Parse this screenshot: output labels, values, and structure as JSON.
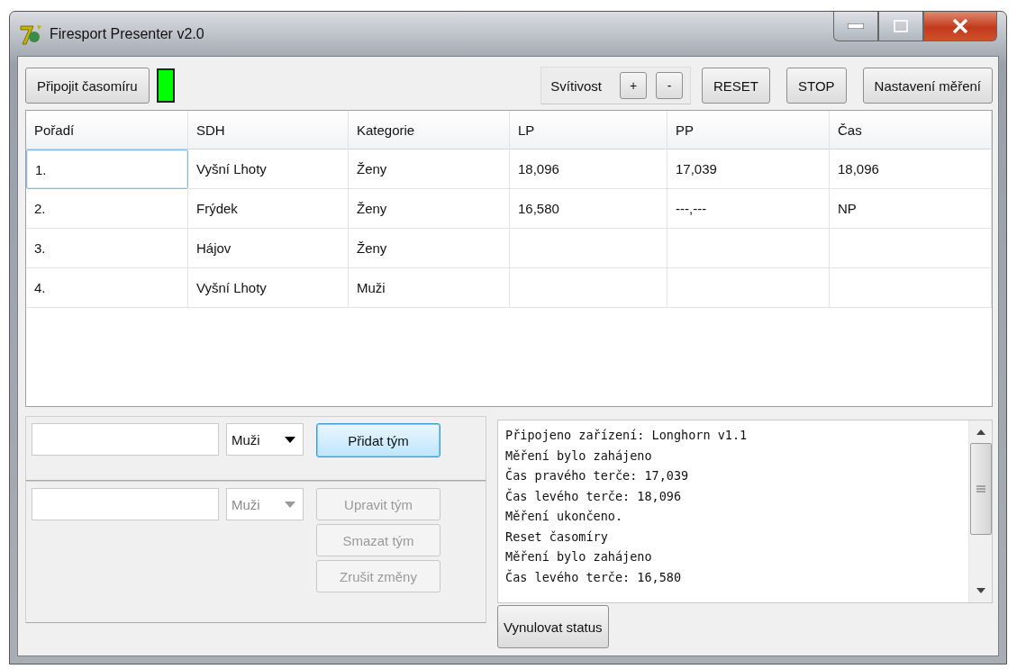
{
  "window": {
    "title": "Firesport Presenter v2.0"
  },
  "toolbar": {
    "connect_button": "Připojit časomíru",
    "connection_ok": true,
    "brightness_label": "Svítivost",
    "plus_button": "+",
    "minus_button": "-",
    "buttons": [
      "RESET",
      "STOP",
      "Nastavení měření"
    ]
  },
  "table": {
    "columns": [
      "Pořadí",
      "SDH",
      "Kategorie",
      "LP",
      "PP",
      "Čas"
    ],
    "rows": [
      {
        "selected": true,
        "cells": [
          "1.",
          "Vyšní Lhoty",
          "Ženy",
          "18,096",
          "17,039",
          "18,096"
        ]
      },
      {
        "selected": false,
        "cells": [
          "2.",
          "Frýdek",
          "Ženy",
          "16,580",
          "---,---",
          "NP"
        ]
      },
      {
        "selected": false,
        "cells": [
          "3.",
          "Hájov",
          "Ženy",
          "",
          "",
          ""
        ]
      },
      {
        "selected": false,
        "cells": [
          "4.",
          "Vyšní Lhoty",
          "Muži",
          "",
          "",
          ""
        ]
      }
    ]
  },
  "add_team": {
    "category": "Muži",
    "disabled": false,
    "button": "Přidat tým"
  },
  "edit_team": {
    "category": "Muži",
    "disabled": true,
    "buttons": [
      "Upravit tým",
      "Smazat tým",
      "Zrušit změny"
    ]
  },
  "log": {
    "lines": [
      "Připojeno zařízení: Longhorn v1.1",
      "Měření bylo zahájeno",
      "Čas pravého terče: 17,039",
      "Čas levého terče: 18,096",
      "Měření ukončeno.",
      "Reset časomíry",
      "Měření bylo zahájeno",
      "Čas levého terče: 16,580"
    ]
  },
  "reset_status_button": "Vynulovat status"
}
